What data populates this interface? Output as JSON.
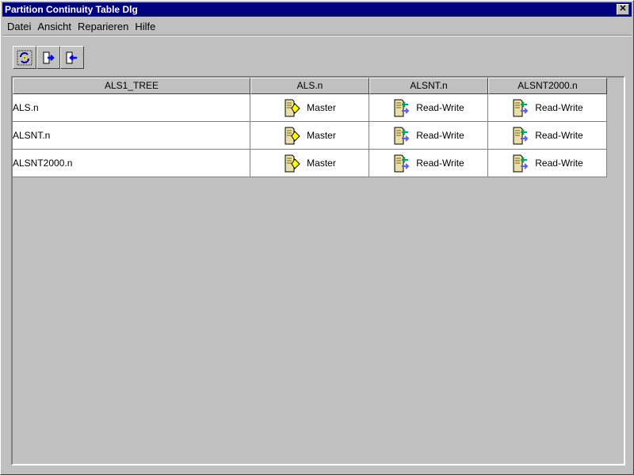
{
  "window": {
    "title": "Partition Continuity Table Dlg",
    "close": "✕"
  },
  "menu": [
    "Datei",
    "Ansicht",
    "Reparieren",
    "Hilfe"
  ],
  "toolbar": [
    {
      "icon": "refresh-icon"
    },
    {
      "icon": "export-icon"
    },
    {
      "icon": "import-icon"
    }
  ],
  "table": {
    "headers": [
      "ALS1_TREE",
      "ALS.n",
      "ALSNT.n",
      "ALSNT2000.n"
    ],
    "rows": [
      {
        "name": "ALS.n",
        "cells": [
          "Master",
          "Read-Write",
          "Read-Write"
        ]
      },
      {
        "name": "ALSNT.n",
        "cells": [
          "Master",
          "Read-Write",
          "Read-Write"
        ]
      },
      {
        "name": "ALSNT2000.n",
        "cells": [
          "Master",
          "Read-Write",
          "Read-Write"
        ]
      }
    ]
  }
}
